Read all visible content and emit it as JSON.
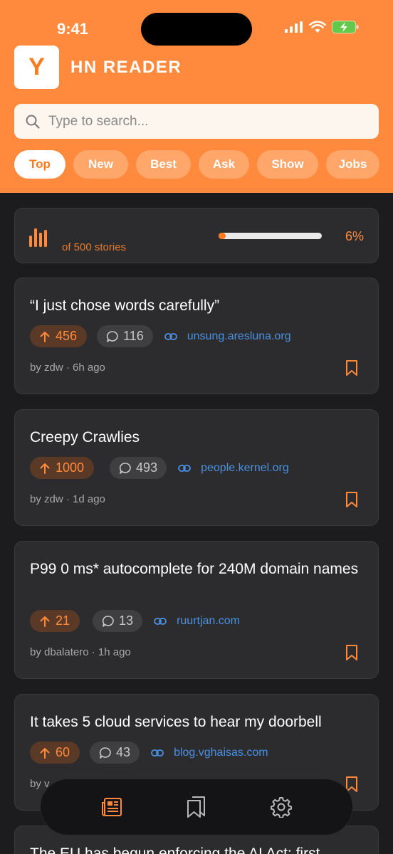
{
  "status_bar": {
    "time": "9:41"
  },
  "app": {
    "logo_letter": "Y",
    "title": "HN READER"
  },
  "search": {
    "placeholder": "Type to search..."
  },
  "tabs": [
    {
      "label": "Top",
      "active": true
    },
    {
      "label": "New",
      "active": false
    },
    {
      "label": "Best",
      "active": false
    },
    {
      "label": "Ask",
      "active": false
    },
    {
      "label": "Show",
      "active": false
    },
    {
      "label": "Jobs",
      "active": false
    }
  ],
  "progress": {
    "label": "of 500 stories",
    "percent_text": "6%",
    "fraction": 0.06
  },
  "stories": [
    {
      "title": "“I just chose words carefully”",
      "points": "456",
      "comments": "116",
      "domain": "unsung.aresluna.org",
      "byline": "by zdw · 6h ago"
    },
    {
      "title": "Creepy Crawlies",
      "points": "1000",
      "comments": "493",
      "domain": "people.kernel.org",
      "byline": "by zdw · 1d ago"
    },
    {
      "title": "P99 0 ms* autocomplete for 240M domain names",
      "points": "21",
      "comments": "13",
      "domain": "ruurtjan.com",
      "byline": "by dbalatero · 1h ago"
    },
    {
      "title": "It takes 5 cloud services to hear my doorbell",
      "points": "60",
      "comments": "43",
      "domain": "blog.vghaisas.com",
      "byline": "by v"
    },
    {
      "title": "The EU has begun enforcing the AI Act: first"
    }
  ],
  "bottom_nav": [
    {
      "icon": "newspaper-icon",
      "active": true
    },
    {
      "icon": "bookmarks-icon",
      "active": false
    },
    {
      "icon": "gear-icon",
      "active": false
    }
  ],
  "colors": {
    "accent": "#ff8a3d",
    "background": "#1c1c1e",
    "card": "#2c2c2e",
    "link": "#4a90e2"
  }
}
